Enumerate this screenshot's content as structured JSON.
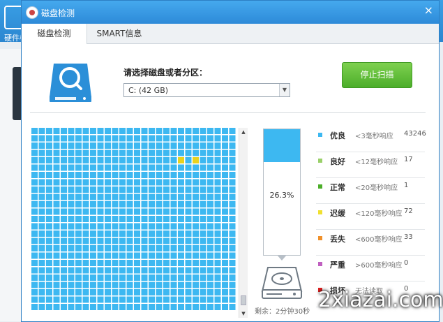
{
  "background_app": {
    "label": "硬件检"
  },
  "dialog": {
    "title": "磁盘检测",
    "close_glyph": "×",
    "tabs": [
      {
        "label": "磁盘检测",
        "active": true
      },
      {
        "label": "SMART信息",
        "active": false
      }
    ],
    "select_label": "请选择磁盘或者分区：",
    "select_value": "C: (42 GB)",
    "stop_button": "停止扫描",
    "progress": {
      "percent_text": "26.3%",
      "fraction": 0.263
    },
    "remaining": "剩余：2分钟30秒",
    "legend": [
      {
        "name": "优良",
        "desc": "<3毫秒响应",
        "count": "43246",
        "color": "#3db8f1"
      },
      {
        "name": "良好",
        "desc": "<12毫秒响应",
        "count": "17",
        "color": "#9ad06a"
      },
      {
        "name": "正常",
        "desc": "<20毫秒响应",
        "count": "1",
        "color": "#4cae2a"
      },
      {
        "name": "迟缓",
        "desc": "<120毫秒响应",
        "count": "72",
        "color": "#f0e030"
      },
      {
        "name": "丢失",
        "desc": "<600毫秒响应",
        "count": "33",
        "color": "#f0902a"
      },
      {
        "name": "严重",
        "desc": ">600毫秒响应",
        "count": "0",
        "color": "#c060c0"
      },
      {
        "name": "损坏",
        "desc": "无法读取",
        "count": "0",
        "color": "#e02020"
      }
    ],
    "grid": {
      "tile_color": "#3db8f1",
      "highlight_color": "#e8d21e"
    }
  },
  "watermark": "2xiazai.com"
}
